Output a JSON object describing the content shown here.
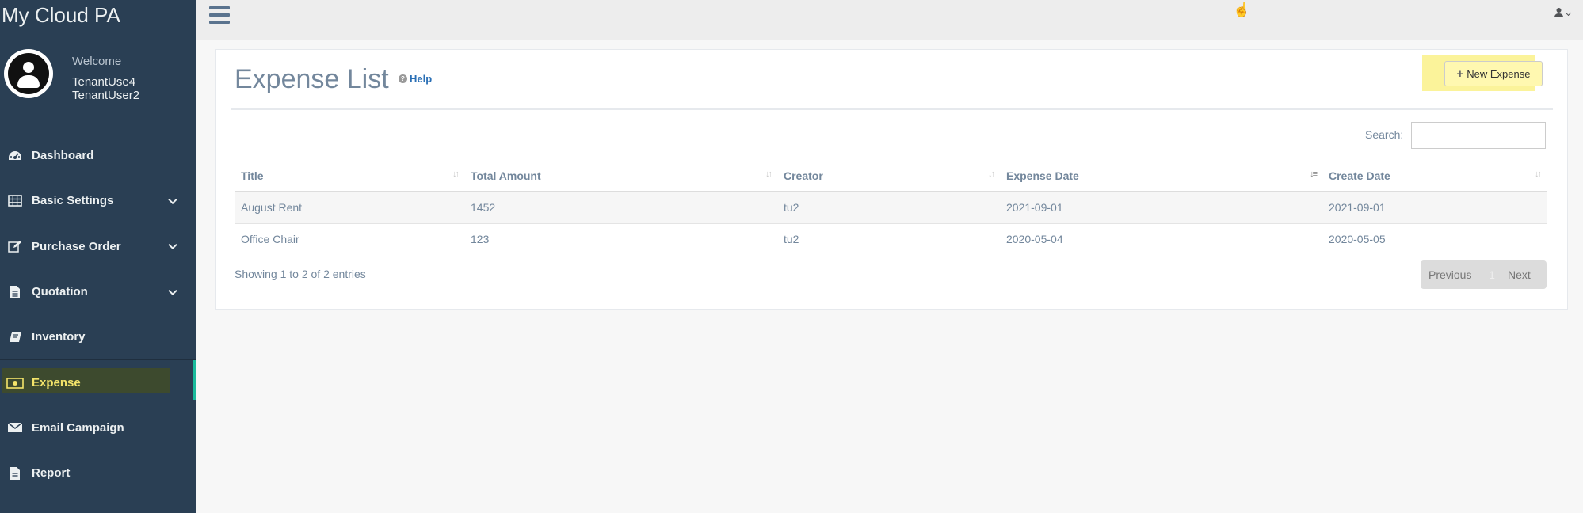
{
  "app": {
    "title": "My Cloud PA"
  },
  "profile": {
    "welcome": "Welcome",
    "user1": "TenantUse4",
    "user2": "TenantUser2"
  },
  "sidebar": {
    "items": [
      {
        "label": "Dashboard",
        "icon": "dashboard-icon",
        "expandable": false
      },
      {
        "label": "Basic Settings",
        "icon": "table-icon",
        "expandable": true
      },
      {
        "label": "Purchase Order",
        "icon": "edit-icon",
        "expandable": true
      },
      {
        "label": "Quotation",
        "icon": "document-icon",
        "expandable": true
      },
      {
        "label": "Inventory",
        "icon": "book-icon",
        "expandable": false
      },
      {
        "label": "Expense",
        "icon": "money-icon",
        "expandable": false,
        "active": true
      },
      {
        "label": "Email Campaign",
        "icon": "envelope-icon",
        "expandable": false
      },
      {
        "label": "Report",
        "icon": "report-icon",
        "expandable": false
      }
    ]
  },
  "page": {
    "title": "Expense List",
    "help": "Help",
    "new_button": "New Expense",
    "search_label": "Search:",
    "search_value": ""
  },
  "table": {
    "columns": [
      "Title",
      "Total Amount",
      "Creator",
      "Expense Date",
      "Create Date"
    ],
    "rows": [
      [
        "August Rent",
        "1452",
        "tu2",
        "2021-09-01",
        "2021-09-01"
      ],
      [
        "Office Chair",
        "123",
        "tu2",
        "2020-05-04",
        "2020-05-05"
      ]
    ]
  },
  "footer": {
    "info": "Showing 1 to 2 of 2 entries",
    "previous": "Previous",
    "page": "1",
    "next": "Next"
  },
  "colors": {
    "sidebar": "#2a3f54",
    "active_bar": "#1abb9c",
    "highlight": "#fbf39a"
  }
}
